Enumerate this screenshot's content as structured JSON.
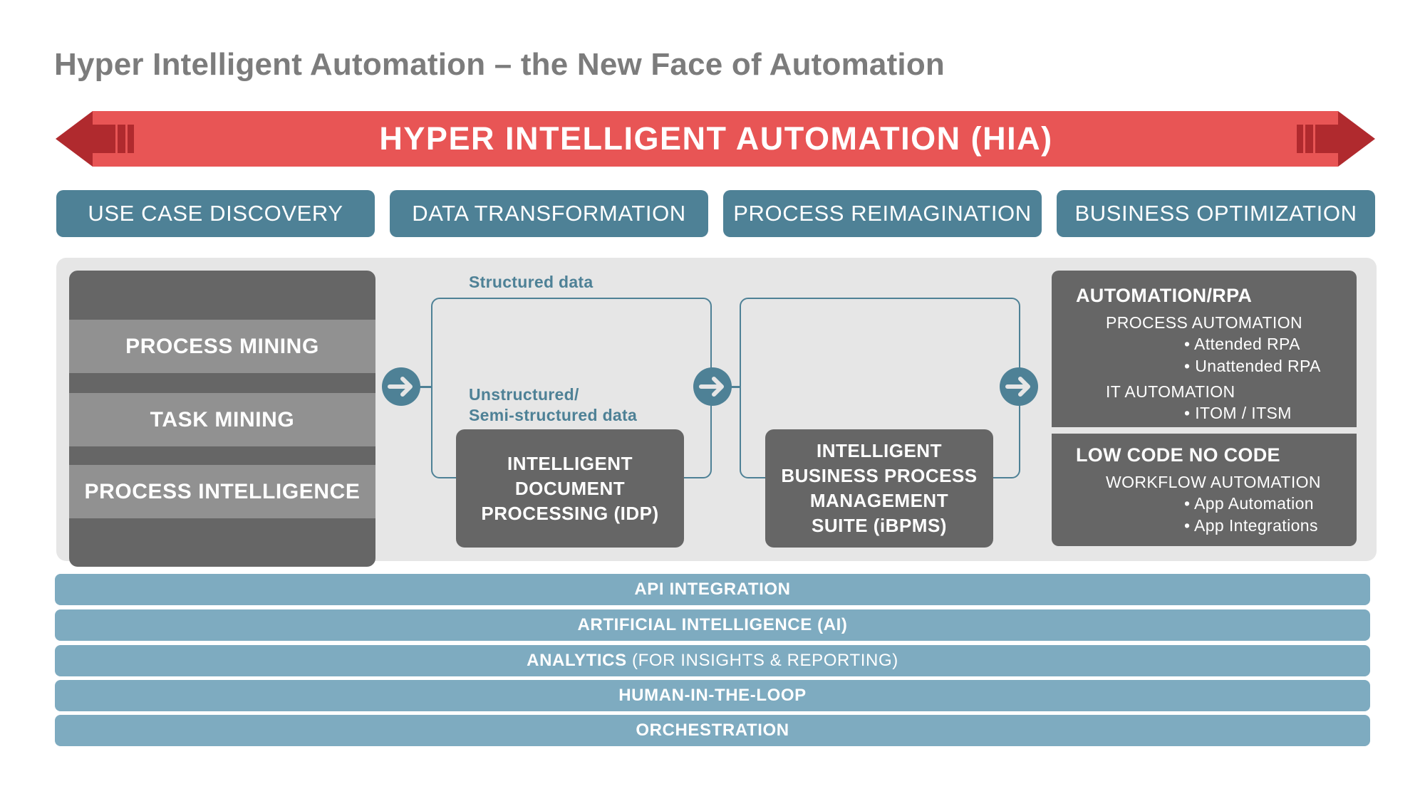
{
  "title": "Hyper Intelligent Automation – the New Face of Automation",
  "banner": {
    "label": "HYPER INTELLIGENT AUTOMATION (HIA)",
    "color": "#e85555",
    "arrow_color": "#b02a2e",
    "left_icon": "double-arrow-left-icon",
    "right_icon": "double-arrow-right-icon"
  },
  "phases": [
    {
      "label": "USE CASE DISCOVERY"
    },
    {
      "label": "DATA TRANSFORMATION"
    },
    {
      "label": "PROCESS REIMAGINATION"
    },
    {
      "label": "BUSINESS OPTIMIZATION"
    }
  ],
  "discovery": {
    "items": [
      {
        "label": "PROCESS MINING"
      },
      {
        "label": "TASK MINING"
      },
      {
        "label": "PROCESS INTELLIGENCE"
      }
    ]
  },
  "data_transformation": {
    "structured_label": "Structured data",
    "unstructured_label_line1": "Unstructured/",
    "unstructured_label_line2": "Semi-structured data",
    "box": {
      "line1": "INTELLIGENT",
      "line2": "DOCUMENT",
      "line3": "PROCESSING (IDP)"
    }
  },
  "process_reimagination": {
    "box": {
      "line1": "INTELLIGENT",
      "line2": "BUSINESS PROCESS",
      "line3": "MANAGEMENT",
      "line4": "SUITE (iBPMS)"
    }
  },
  "optimization": {
    "panels": [
      {
        "title": "AUTOMATION/RPA",
        "groups": [
          {
            "heading": "PROCESS AUTOMATION",
            "bullets": [
              "• Attended RPA",
              "• Unattended RPA"
            ]
          },
          {
            "heading": "IT AUTOMATION",
            "bullets": [
              "• ITOM / ITSM"
            ]
          }
        ]
      },
      {
        "title": "LOW CODE NO CODE",
        "groups": [
          {
            "heading": "WORKFLOW AUTOMATION",
            "bullets": [
              "• App Automation",
              "• App Integrations"
            ]
          }
        ]
      }
    ]
  },
  "flow_arrows": [
    "arrow-right-icon",
    "arrow-right-icon",
    "arrow-right-icon"
  ],
  "layers": [
    {
      "bold": "API INTEGRATION",
      "regular": ""
    },
    {
      "bold": "ARTIFICIAL INTELLIGENCE (AI)",
      "regular": ""
    },
    {
      "bold": "ANALYTICS",
      "regular": " (FOR INSIGHTS & REPORTING)"
    },
    {
      "bold": "HUMAN-IN-THE-LOOP",
      "regular": ""
    },
    {
      "bold": "ORCHESTRATION",
      "regular": ""
    }
  ],
  "colors": {
    "phase": "#4e8196",
    "layer": "#7eabc0",
    "dark_box": "#666666",
    "band": "#919191",
    "canvas": "#e6e6e6",
    "title": "#7c7c7c"
  }
}
